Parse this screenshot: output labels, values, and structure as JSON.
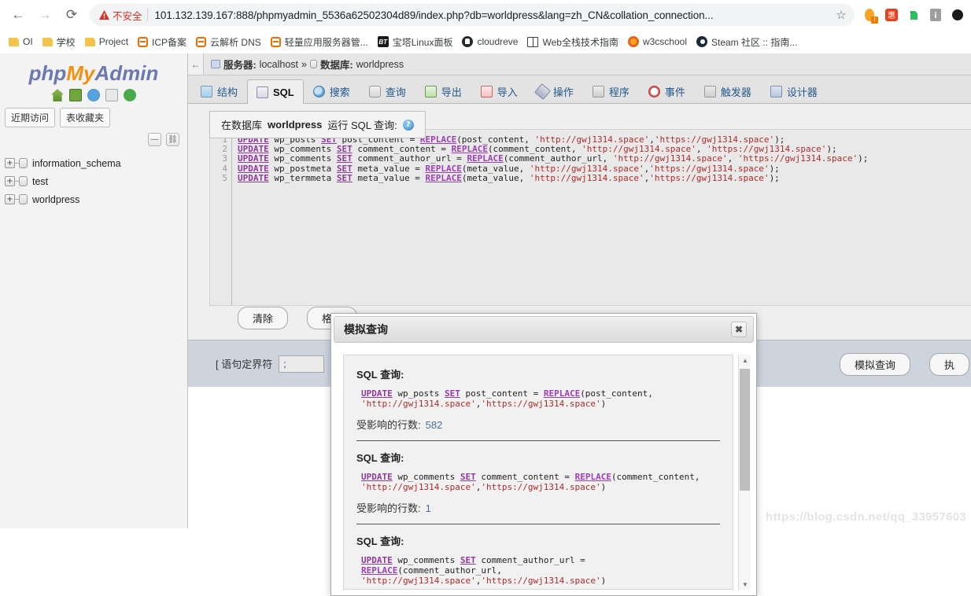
{
  "browser": {
    "nav": {
      "back": "←",
      "forward": "→",
      "reload": "⟳"
    },
    "security_warning": "不安全",
    "url": "101.132.139.167:888/phpmyadmin_5536a62502304d89/index.php?db=worldpress&lang=zh_CN&collation_connection...",
    "star": "☆",
    "extensions": [
      "egg-icon",
      "discount-icon",
      "evernote-icon",
      "info-icon",
      "dark-circle-icon"
    ],
    "bookmarks": [
      {
        "label": "OI",
        "icon": "folder-icon"
      },
      {
        "label": "学校",
        "icon": "folder-icon"
      },
      {
        "label": "Project",
        "icon": "folder-icon"
      },
      {
        "label": "ICP备案",
        "icon": "link-icon"
      },
      {
        "label": "云解析 DNS",
        "icon": "link-icon"
      },
      {
        "label": "轻量应用服务器管...",
        "icon": "link-icon"
      },
      {
        "label": "宝塔Linux面板",
        "icon": "bt-icon"
      },
      {
        "label": "cloudreve",
        "icon": "github-icon"
      },
      {
        "label": "Web全栈技术指南",
        "icon": "book-icon"
      },
      {
        "label": "w3cschool",
        "icon": "w3c-icon"
      },
      {
        "label": "Steam 社区 :: 指南...",
        "icon": "steam-icon"
      }
    ]
  },
  "sidebar": {
    "logo": {
      "php": "php",
      "my": "My",
      "admin": "Admin"
    },
    "icons": [
      "home-icon",
      "exit-icon",
      "help-icon",
      "docs-icon",
      "reload-icon"
    ],
    "pills": [
      "近期访问",
      "表收藏夹"
    ],
    "mini_buttons": [
      "collapse-icon",
      "link-icon"
    ],
    "databases": [
      "information_schema",
      "test",
      "worldpress"
    ]
  },
  "breadcrumb": {
    "back_arrow": "←",
    "server_label": "服务器:",
    "server_name": "localhost",
    "separator": "»",
    "db_label": "数据库:",
    "db_name": "worldpress"
  },
  "tabs": [
    {
      "label": "结构",
      "icon": "structure-icon",
      "active": false
    },
    {
      "label": "SQL",
      "icon": "sql-icon",
      "active": true
    },
    {
      "label": "搜索",
      "icon": "search-icon",
      "active": false
    },
    {
      "label": "查询",
      "icon": "query-icon",
      "active": false
    },
    {
      "label": "导出",
      "icon": "export-icon",
      "active": false
    },
    {
      "label": "导入",
      "icon": "import-icon",
      "active": false
    },
    {
      "label": "操作",
      "icon": "operations-icon",
      "active": false
    },
    {
      "label": "程序",
      "icon": "routines-icon",
      "active": false
    },
    {
      "label": "事件",
      "icon": "events-icon",
      "active": false
    },
    {
      "label": "触发器",
      "icon": "triggers-icon",
      "active": false
    },
    {
      "label": "设计器",
      "icon": "designer-icon",
      "active": false
    }
  ],
  "sql_panel": {
    "legend_prefix": "在数据库",
    "legend_db": "worldpress",
    "legend_suffix": "运行 SQL 查询:",
    "help_glyph": "?",
    "line_numbers": [
      "1",
      "2",
      "3",
      "4",
      "5"
    ],
    "buttons": {
      "clear": "清除",
      "format": "格式"
    },
    "delimiter_label": "[ 语句定界符",
    "delimiter_value": ";",
    "delimiter_close": "]",
    "simulate_button": "模拟查询",
    "execute_button": "执"
  },
  "modal": {
    "title": "模拟查询",
    "close_glyph": "✖",
    "rows_label": "受影响的行数:",
    "query_label": "SQL 查询:",
    "entries": [
      {
        "table": "wp_posts",
        "column": "post_content",
        "rows": "582"
      },
      {
        "table": "wp_comments",
        "column": "comment_content",
        "rows": "1"
      },
      {
        "table": "wp_comments",
        "column": "comment_author_url",
        "rows": ""
      }
    ],
    "scroll": {
      "up": "▲",
      "down": "▼"
    }
  },
  "watermark": "https://blog.csdn.net/qq_33957603",
  "colors": {
    "accent_orange": "#f29111",
    "accent_blue": "#6c78af",
    "warning_red": "#d93025",
    "sql_keyword": "#8e3a9e",
    "sql_string": "#b02b2b"
  }
}
